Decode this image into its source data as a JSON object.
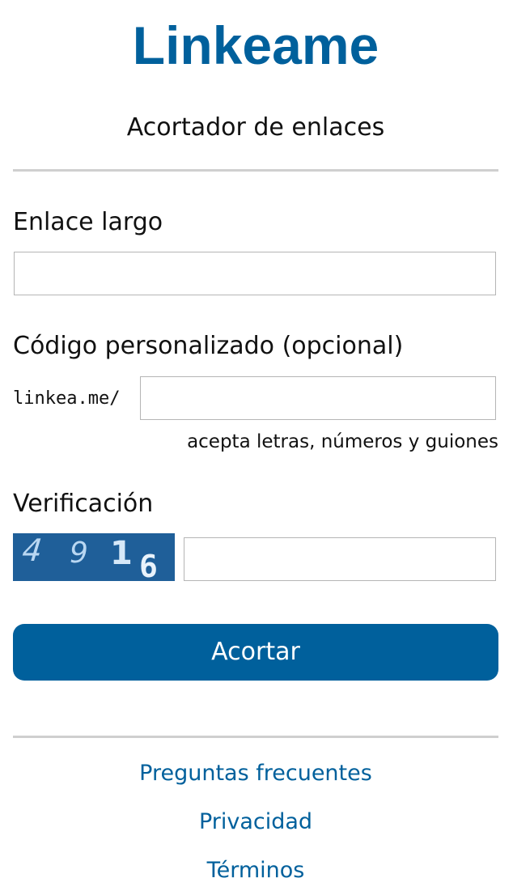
{
  "header": {
    "brand": "Linkeame",
    "tagline": "Acortador de enlaces"
  },
  "form": {
    "long_link": {
      "label": "Enlace largo",
      "value": "",
      "placeholder": ""
    },
    "custom_code": {
      "label": "Código personalizado (opcional)",
      "prefix": "linkea.me/",
      "value": "",
      "placeholder": "",
      "hint": "acepta letras, números y guiones"
    },
    "verification": {
      "label": "Verificación",
      "captcha_text": "4916",
      "value": "",
      "placeholder": ""
    },
    "submit_label": "Acortar"
  },
  "footer": {
    "links": [
      {
        "label": "Preguntas frecuentes"
      },
      {
        "label": "Privacidad"
      },
      {
        "label": "Términos"
      }
    ]
  },
  "colors": {
    "brand": "#00609c",
    "captcha_bg": "#1f5f99",
    "rule": "#cfcfcf",
    "input_border": "#b5b5b5"
  }
}
